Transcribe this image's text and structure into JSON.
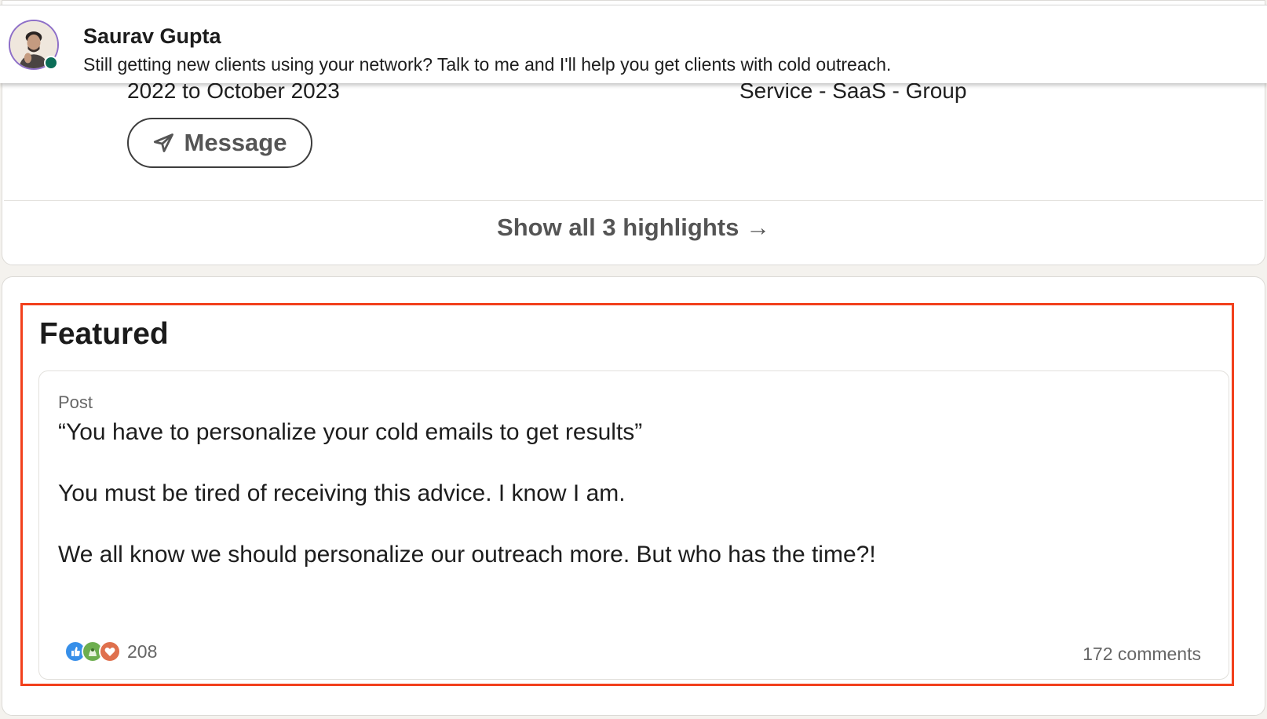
{
  "notification": {
    "name": "Saurav Gupta",
    "message": "Still getting new clients using your network? Talk to me and I'll help you get clients with cold outreach."
  },
  "highlights": {
    "dates": "2022 to October 2023",
    "group": "Service - SaaS - Group",
    "message_label": "Message",
    "show_all_label": "Show all 3 highlights →"
  },
  "featured": {
    "title": "Featured",
    "post": {
      "type": "Post",
      "lines": [
        "“You have to personalize your cold emails to get results”",
        "You must be tired of receiving this advice. I know I am.",
        "We all know we should personalize our outreach more. But who has the time?!"
      ],
      "reactions_count": "208",
      "comments": "172 comments"
    }
  },
  "colors": {
    "highlight_border": "#f2401c",
    "presence": "#0b6e58",
    "like": "#378fe9",
    "celebrate": "#6dae4f",
    "love": "#df704d"
  }
}
